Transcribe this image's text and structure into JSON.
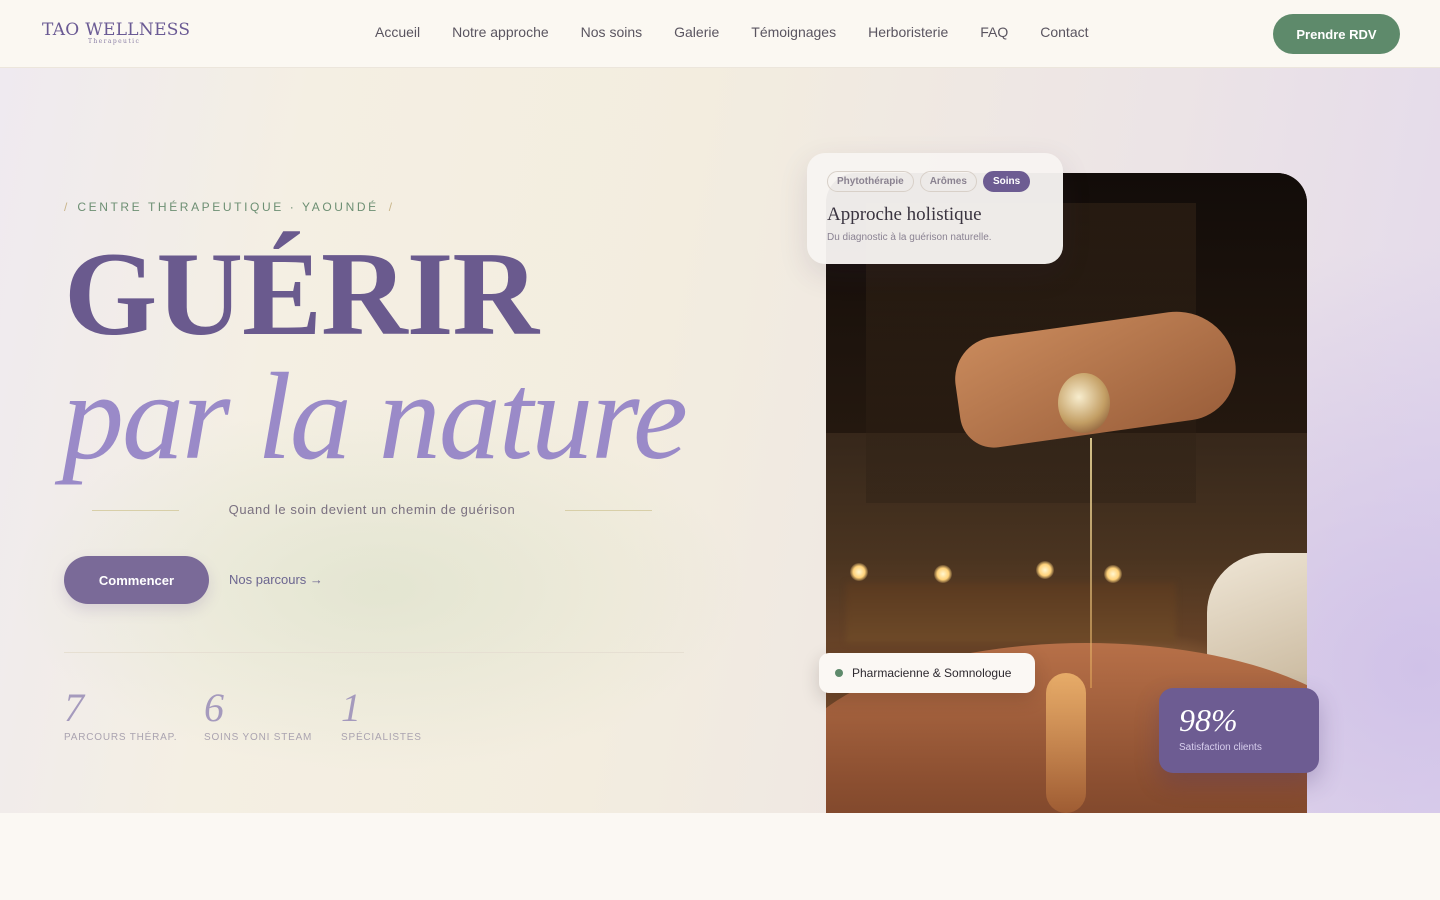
{
  "brand": {
    "name": "TAO WELLNESS",
    "subtitle": "Therapeutic"
  },
  "nav": {
    "links": [
      "Accueil",
      "Notre approche",
      "Nos soins",
      "Galerie",
      "Témoignages",
      "Herboristerie",
      "FAQ",
      "Contact"
    ],
    "cta": "Prendre RDV"
  },
  "hero": {
    "eyebrow": "CENTRE THÉRAPEUTIQUE · YAOUNDÉ",
    "slash": "/",
    "headline_1": "GUÉRIR",
    "headline_2": "par la nature",
    "tagline": "Quand le soin devient un chemin de guérison",
    "primary_button": "Commencer",
    "secondary_link": "Nos parcours →",
    "stats": [
      {
        "value": "7",
        "label": "PARCOURS THÉRAP."
      },
      {
        "value": "6",
        "label": "SOINS YONI STEAM"
      },
      {
        "value": "1",
        "label": "SPÉCIALISTES"
      }
    ]
  },
  "approach_card": {
    "chips": [
      "Phytothérapie",
      "Arômes",
      "Soins"
    ],
    "active_chip": "Soins",
    "title": "Approche holistique",
    "subtitle": "Du diagnostic à la guérison naturelle."
  },
  "specialist_badge": {
    "text": "Pharmacienne & Somnologue"
  },
  "satisfaction_card": {
    "value": "98%",
    "label": "Satisfaction clients"
  },
  "colors": {
    "primary_purple": "#6d5c92",
    "light_purple": "#9a8ac8",
    "sage_green": "#5e8a6b",
    "cream": "#fbf8f3"
  },
  "icons": [
    "status-dot-icon",
    "arrow-right-icon"
  ]
}
